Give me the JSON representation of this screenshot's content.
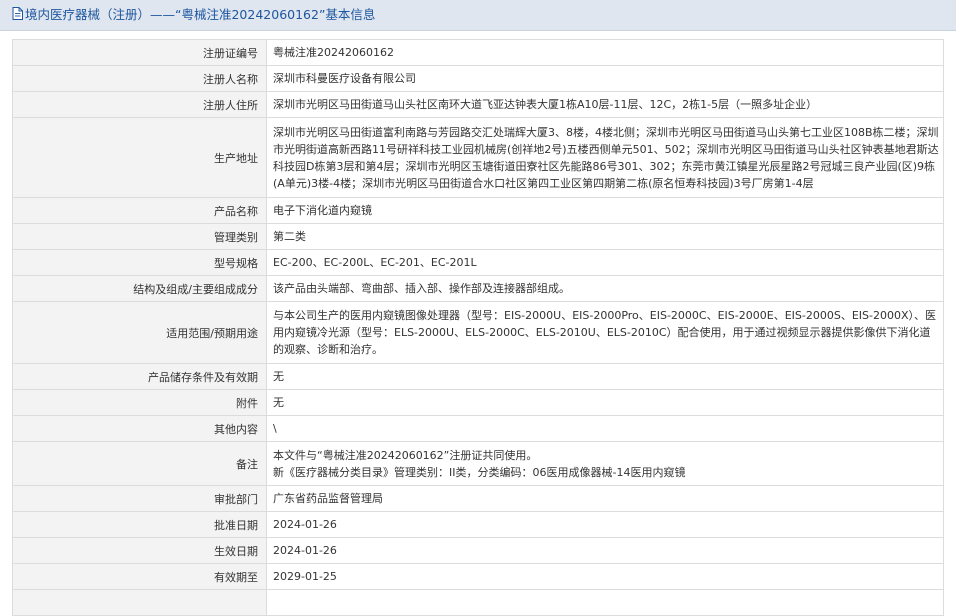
{
  "header": {
    "title": "境内医疗器械（注册）——“粤械注准20242060162”基本信息"
  },
  "rows": [
    {
      "label": "注册证编号",
      "value": "粤械注准20242060162"
    },
    {
      "label": "注册人名称",
      "value": "深圳市科曼医疗设备有限公司"
    },
    {
      "label": "注册人住所",
      "value": "深圳市光明区马田街道马山头社区南环大道飞亚达钟表大厦1栋A10层-11层、12C，2栋1-5层（一照多址企业）"
    },
    {
      "label": "生产地址",
      "value": "深圳市光明区马田街道富利南路与芳园路交汇处瑞辉大厦3、8楼，4楼北侧；深圳市光明区马田街道马山头第七工业区108B栋二楼；深圳市光明街道高新西路11号研祥科技工业园机械房(创祥地2号)五楼西侧单元501、502；深圳市光明区马田街道马山头社区钟表基地君斯达科技园D栋第3层和第4层；深圳市光明区玉塘街道田寮社区先能路86号301、302；东莞市黄江镇星光辰星路2号冠城三良产业园(区)9栋(A单元)3楼-4楼；深圳市光明区马田街道合水口社区第四工业区第四期第二栋(原名恒寿科技园)3号厂房第1-4层"
    },
    {
      "label": "产品名称",
      "value": "电子下消化道内窥镜"
    },
    {
      "label": "管理类别",
      "value": "第二类"
    },
    {
      "label": "型号规格",
      "value": "EC-200、EC-200L、EC-201、EC-201L"
    },
    {
      "label": "结构及组成/主要组成成分",
      "value": "该产品由头端部、弯曲部、插入部、操作部及连接器部组成。"
    },
    {
      "label": "适用范围/预期用途",
      "value": "与本公司生产的医用内窥镜图像处理器（型号：EIS-2000U、EIS-2000Pro、EIS-2000C、EIS-2000E、EIS-2000S、EIS-2000X）、医用内窥镜冷光源（型号：ELS-2000U、ELS-2000C、ELS-2010U、ELS-2010C）配合使用，用于通过视频显示器提供影像供下消化道的观察、诊断和治疗。"
    },
    {
      "label": "产品储存条件及有效期",
      "value": "无"
    },
    {
      "label": "附件",
      "value": "无"
    },
    {
      "label": "其他内容",
      "value": "\\"
    },
    {
      "label": "备注",
      "value": "本文件与“粤械注准20242060162”注册证共同使用。\n新《医疗器械分类目录》管理类别：II类，分类编码：06医用成像器械-14医用内窥镜"
    },
    {
      "label": "审批部门",
      "value": "广东省药品监督管理局"
    },
    {
      "label": "批准日期",
      "value": "2024-01-26"
    },
    {
      "label": "生效日期",
      "value": "2024-01-26"
    },
    {
      "label": "有效期至",
      "value": "2029-01-25"
    },
    {
      "label": "",
      "value": ""
    }
  ]
}
